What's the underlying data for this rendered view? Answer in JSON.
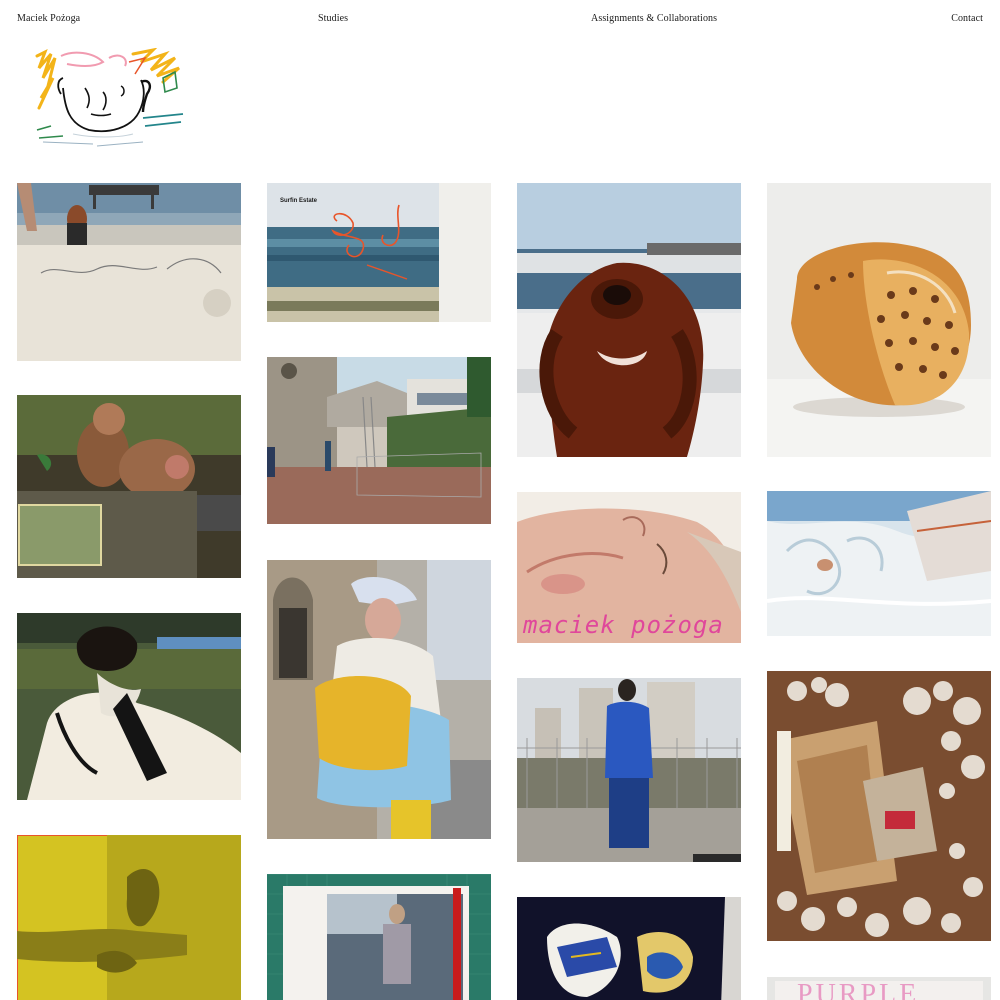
{
  "site": {
    "owner_name": "Maciek Pożoga"
  },
  "nav": {
    "studies": "Studies",
    "assignments": "Assignments & Collaborations",
    "contact": "Contact"
  },
  "tiles": {
    "surfin_label": "Surfin Estate",
    "cover_name": "maciek pożoga",
    "purple_label": "PURPLE"
  },
  "colors": {
    "background": "#ffffff",
    "text": "#1a1a1a",
    "accent_pink": "#e0479b",
    "accent_orange": "#e8552a"
  }
}
